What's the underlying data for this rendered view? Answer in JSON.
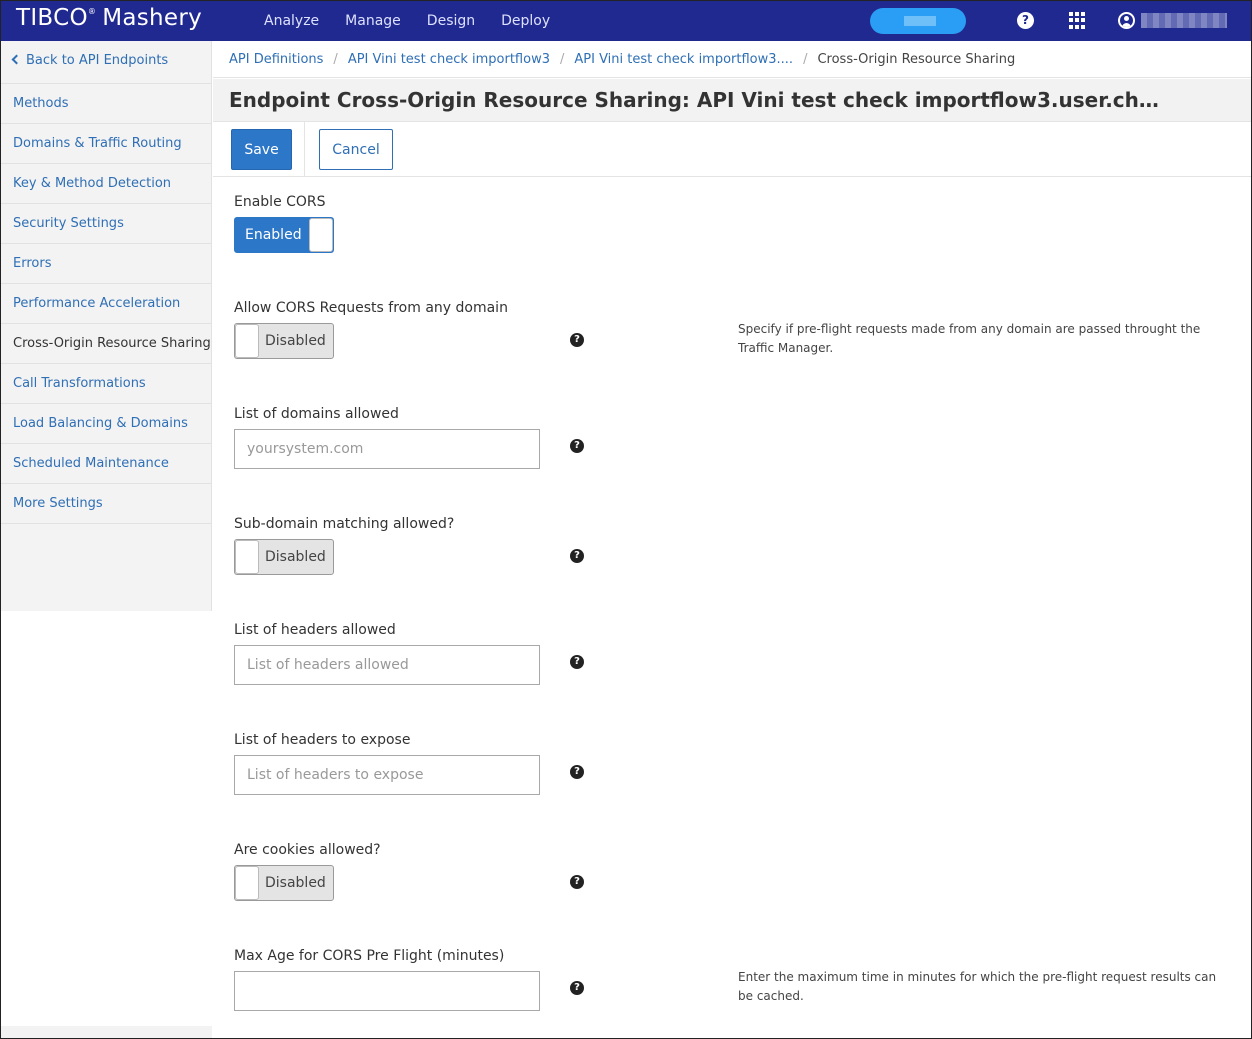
{
  "topbar": {
    "brand": "TIBC",
    "brand_mark": "®",
    "product": "Mashery",
    "nav": [
      "Analyze",
      "Manage",
      "Design",
      "Deploy"
    ],
    "help_icon": "question-circle-icon",
    "apps_icon": "grid-icon",
    "user_icon": "user-circle-icon"
  },
  "sidebar": {
    "back_label": "Back to API Endpoints",
    "items": [
      {
        "label": "Methods"
      },
      {
        "label": "Domains & Traffic Routing"
      },
      {
        "label": "Key & Method Detection"
      },
      {
        "label": "Security Settings"
      },
      {
        "label": "Errors"
      },
      {
        "label": "Performance Acceleration"
      },
      {
        "label": "Cross-Origin Resource Sharing"
      },
      {
        "label": "Call Transformations"
      },
      {
        "label": "Load Balancing & Domains"
      },
      {
        "label": "Scheduled Maintenance"
      },
      {
        "label": "More Settings"
      }
    ],
    "active_index": 6
  },
  "breadcrumb": [
    "API Definitions",
    "API Vini test check importflow3",
    "API Vini test check importflow3....",
    "Cross-Origin Resource Sharing"
  ],
  "page_title": "Endpoint Cross-Origin Resource Sharing: API Vini test check importflow3.user.ch…",
  "actions": {
    "save": "Save",
    "cancel": "Cancel"
  },
  "form": {
    "enable_cors": {
      "label": "Enable CORS",
      "state": "Enabled"
    },
    "allow_any_domain": {
      "label": "Allow CORS Requests from any domain",
      "state": "Disabled",
      "help": "Specify if pre-flight requests made from any domain are passed throught the Traffic Manager."
    },
    "domains_allowed": {
      "label": "List of domains allowed",
      "placeholder": "yoursystem.com",
      "value": ""
    },
    "subdomain_matching": {
      "label": "Sub-domain matching allowed?",
      "state": "Disabled"
    },
    "headers_allowed": {
      "label": "List of headers allowed",
      "placeholder": "List of headers allowed",
      "value": ""
    },
    "headers_expose": {
      "label": "List of headers to expose",
      "placeholder": "List of headers to expose",
      "value": ""
    },
    "cookies_allowed": {
      "label": "Are cookies allowed?",
      "state": "Disabled"
    },
    "max_age": {
      "label": "Max Age for CORS Pre Flight (minutes)",
      "value": "",
      "help": "Enter the maximum time in minutes for which the pre-flight request results can be cached."
    }
  },
  "colors": {
    "topbar": "#20298f",
    "primary": "#2d77c8",
    "link": "#2f6fb5",
    "pill": "#2a9df4"
  }
}
